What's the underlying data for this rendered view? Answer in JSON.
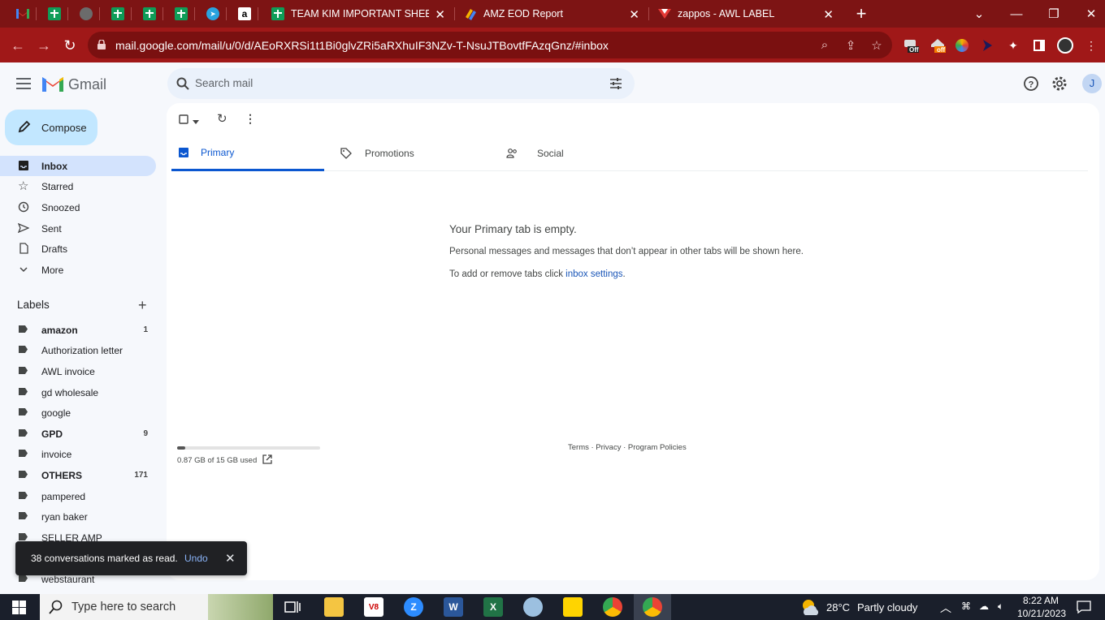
{
  "browser": {
    "tabs": [
      {
        "title": "TEAM KIM IMPORTANT SHEETS"
      },
      {
        "title": "AMZ EOD Report"
      },
      {
        "title": "zappos - AWL LABEL"
      }
    ],
    "url": "mail.google.com/mail/u/0/d/AEoRXRSi1t1Bi0glvZRi5aRXhuIF3NZv-T-NsuJTBovtfFAzqGnz/#inbox",
    "ext_badges": [
      "Off",
      "off"
    ],
    "accent": "#a01818"
  },
  "gmail": {
    "brand": "Gmail",
    "search_placeholder": "Search mail",
    "avatar_letter": "J",
    "compose_label": "Compose",
    "nav": [
      {
        "label": "Inbox",
        "icon": "inbox-icon",
        "active": true
      },
      {
        "label": "Starred",
        "icon": "star-icon"
      },
      {
        "label": "Snoozed",
        "icon": "clock-icon"
      },
      {
        "label": "Sent",
        "icon": "send-icon"
      },
      {
        "label": "Drafts",
        "icon": "draft-icon"
      },
      {
        "label": "More",
        "icon": "chevron-down-icon"
      }
    ],
    "labels_heading": "Labels",
    "labels": [
      {
        "name": "amazon",
        "count": "1",
        "bold": true
      },
      {
        "name": "Authorization letter",
        "count": ""
      },
      {
        "name": "AWL invoice",
        "count": ""
      },
      {
        "name": "gd wholesale",
        "count": ""
      },
      {
        "name": "google",
        "count": ""
      },
      {
        "name": "GPD",
        "count": "9",
        "bold": true
      },
      {
        "name": "invoice",
        "count": ""
      },
      {
        "name": "OTHERS",
        "count": "171",
        "bold": true
      },
      {
        "name": "pampered",
        "count": ""
      },
      {
        "name": "ryan baker",
        "count": ""
      },
      {
        "name": "SELLER AMP",
        "count": ""
      },
      {
        "name": "webstaurant",
        "count": ""
      }
    ],
    "category_tabs": [
      {
        "label": "Primary",
        "icon": "inbox-tab-icon"
      },
      {
        "label": "Promotions",
        "icon": "tag-icon"
      },
      {
        "label": "Social",
        "icon": "people-icon"
      }
    ],
    "empty_state": {
      "title": "Your Primary tab is empty.",
      "line1": "Personal messages and messages that don’t appear in other tabs will be shown here.",
      "line2_prefix": "To add or remove tabs click ",
      "line2_link": "inbox settings",
      "line2_suffix": "."
    },
    "storage": {
      "text": "0.87 GB of 15 GB used",
      "fraction": 0.058
    },
    "footer": "Terms · Privacy · Program Policies",
    "toast": {
      "message": "38 conversations marked as read.",
      "action": "Undo"
    }
  },
  "taskbar": {
    "search_placeholder": "Type here to search",
    "temperature": "28°C",
    "weather": "Partly cloudy",
    "time": "8:22 AM",
    "date": "10/21/2023"
  }
}
